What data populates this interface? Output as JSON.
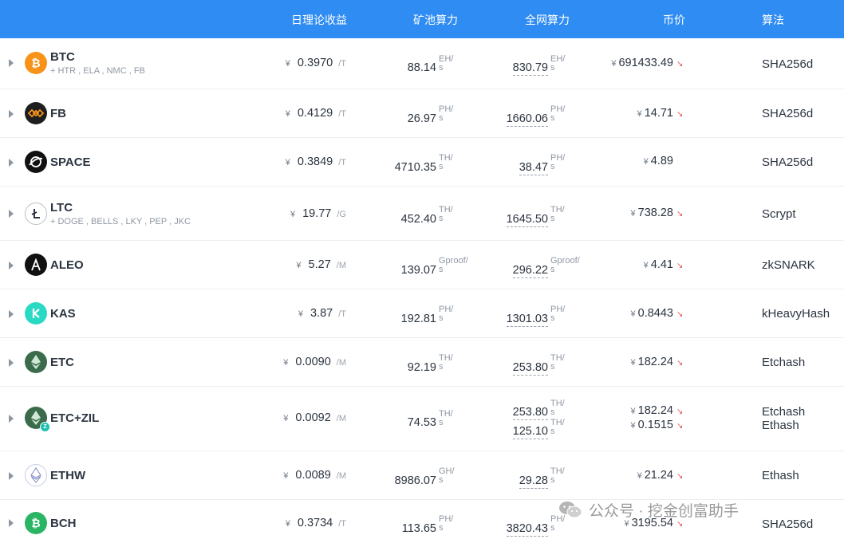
{
  "header": {
    "income": "日理论收益",
    "pool": "矿池算力",
    "net": "全网算力",
    "price": "币价",
    "algo": "算法"
  },
  "colors": {
    "header_bg": "#2f8cf2",
    "trend_down": "#e84d57"
  },
  "rows": [
    {
      "coin": "BTC",
      "merged": "+ HTR , ELA , NMC , FB",
      "icon": "bitcoin-icon",
      "income": {
        "cur": "¥",
        "value": "0.3970",
        "unit": "/T"
      },
      "pool": {
        "value": "88.14",
        "unit_top": "EH/",
        "unit_bottom": "s"
      },
      "net": [
        {
          "value": "830.79",
          "unit_top": "EH/",
          "unit_bottom": "s"
        }
      ],
      "price": [
        {
          "cur": "¥",
          "value": "691433.49",
          "trend": "down"
        }
      ],
      "algo": [
        "SHA256d"
      ]
    },
    {
      "coin": "FB",
      "merged": "",
      "icon": "fractal-bitcoin-icon",
      "income": {
        "cur": "¥",
        "value": "0.4129",
        "unit": "/T"
      },
      "pool": {
        "value": "26.97",
        "unit_top": "PH/",
        "unit_bottom": "s"
      },
      "net": [
        {
          "value": "1660.06",
          "unit_top": "PH/",
          "unit_bottom": "s"
        }
      ],
      "price": [
        {
          "cur": "¥",
          "value": "14.71",
          "trend": "down"
        }
      ],
      "algo": [
        "SHA256d"
      ]
    },
    {
      "coin": "SPACE",
      "merged": "",
      "icon": "space-icon",
      "income": {
        "cur": "¥",
        "value": "0.3849",
        "unit": "/T"
      },
      "pool": {
        "value": "4710.35",
        "unit_top": "TH/",
        "unit_bottom": "s"
      },
      "net": [
        {
          "value": "38.47",
          "unit_top": "PH/",
          "unit_bottom": "s"
        }
      ],
      "price": [
        {
          "cur": "¥",
          "value": "4.89",
          "trend": ""
        }
      ],
      "algo": [
        "SHA256d"
      ]
    },
    {
      "coin": "LTC",
      "merged": "+ DOGE , BELLS , LKY , PEP , JKC",
      "icon": "litecoin-icon",
      "income": {
        "cur": "¥",
        "value": "19.77",
        "unit": "/G"
      },
      "pool": {
        "value": "452.40",
        "unit_top": "TH/",
        "unit_bottom": "s"
      },
      "net": [
        {
          "value": "1645.50",
          "unit_top": "TH/",
          "unit_bottom": "s"
        }
      ],
      "price": [
        {
          "cur": "¥",
          "value": "738.28",
          "trend": "down"
        }
      ],
      "algo": [
        "Scrypt"
      ]
    },
    {
      "coin": "ALEO",
      "merged": "",
      "icon": "aleo-icon",
      "income": {
        "cur": "¥",
        "value": "5.27",
        "unit": "/M"
      },
      "pool": {
        "value": "139.07",
        "unit_top": "Gproof/",
        "unit_bottom": "s"
      },
      "net": [
        {
          "value": "296.22",
          "unit_top": "Gproof/",
          "unit_bottom": "s"
        }
      ],
      "price": [
        {
          "cur": "¥",
          "value": "4.41",
          "trend": "down"
        }
      ],
      "algo": [
        "zkSNARK"
      ]
    },
    {
      "coin": "KAS",
      "merged": "",
      "icon": "kaspa-icon",
      "income": {
        "cur": "¥",
        "value": "3.87",
        "unit": "/T"
      },
      "pool": {
        "value": "192.81",
        "unit_top": "PH/",
        "unit_bottom": "s"
      },
      "net": [
        {
          "value": "1301.03",
          "unit_top": "PH/",
          "unit_bottom": "s"
        }
      ],
      "price": [
        {
          "cur": "¥",
          "value": "0.8443",
          "trend": "down"
        }
      ],
      "algo": [
        "kHeavyHash"
      ]
    },
    {
      "coin": "ETC",
      "merged": "",
      "icon": "ethereum-classic-icon",
      "income": {
        "cur": "¥",
        "value": "0.0090",
        "unit": "/M"
      },
      "pool": {
        "value": "92.19",
        "unit_top": "TH/",
        "unit_bottom": "s"
      },
      "net": [
        {
          "value": "253.80",
          "unit_top": "TH/",
          "unit_bottom": "s"
        }
      ],
      "price": [
        {
          "cur": "¥",
          "value": "182.24",
          "trend": "down"
        }
      ],
      "algo": [
        "Etchash"
      ]
    },
    {
      "coin": "ETC+ZIL",
      "merged": "",
      "icon": "ethereum-classic-zil-icon",
      "income": {
        "cur": "¥",
        "value": "0.0092",
        "unit": "/M"
      },
      "pool": {
        "value": "74.53",
        "unit_top": "TH/",
        "unit_bottom": "s"
      },
      "net": [
        {
          "value": "253.80",
          "unit_top": "TH/",
          "unit_bottom": "s"
        },
        {
          "value": "125.10",
          "unit_top": "TH/",
          "unit_bottom": "s"
        }
      ],
      "price": [
        {
          "cur": "¥",
          "value": "182.24",
          "trend": "down"
        },
        {
          "cur": "¥",
          "value": "0.1515",
          "trend": "down"
        }
      ],
      "algo": [
        "Etchash",
        "Ethash"
      ]
    },
    {
      "coin": "ETHW",
      "merged": "",
      "icon": "ethereum-pow-icon",
      "income": {
        "cur": "¥",
        "value": "0.0089",
        "unit": "/M"
      },
      "pool": {
        "value": "8986.07",
        "unit_top": "GH/",
        "unit_bottom": "s"
      },
      "net": [
        {
          "value": "29.28",
          "unit_top": "TH/",
          "unit_bottom": "s"
        }
      ],
      "price": [
        {
          "cur": "¥",
          "value": "21.24",
          "trend": "down"
        }
      ],
      "algo": [
        "Ethash"
      ]
    },
    {
      "coin": "BCH",
      "merged": "",
      "icon": "bitcoin-cash-icon",
      "income": {
        "cur": "¥",
        "value": "0.3734",
        "unit": "/T"
      },
      "pool": {
        "value": "113.65",
        "unit_top": "PH/",
        "unit_bottom": "s"
      },
      "net": [
        {
          "value": "3820.43",
          "unit_top": "PH/",
          "unit_bottom": "s"
        }
      ],
      "price": [
        {
          "cur": "¥",
          "value": "3195.54",
          "trend": "down"
        }
      ],
      "algo": [
        "SHA256d"
      ]
    }
  ],
  "watermark": {
    "text": "公众号 · 挖金创富助手",
    "icon": "wechat-icon"
  }
}
